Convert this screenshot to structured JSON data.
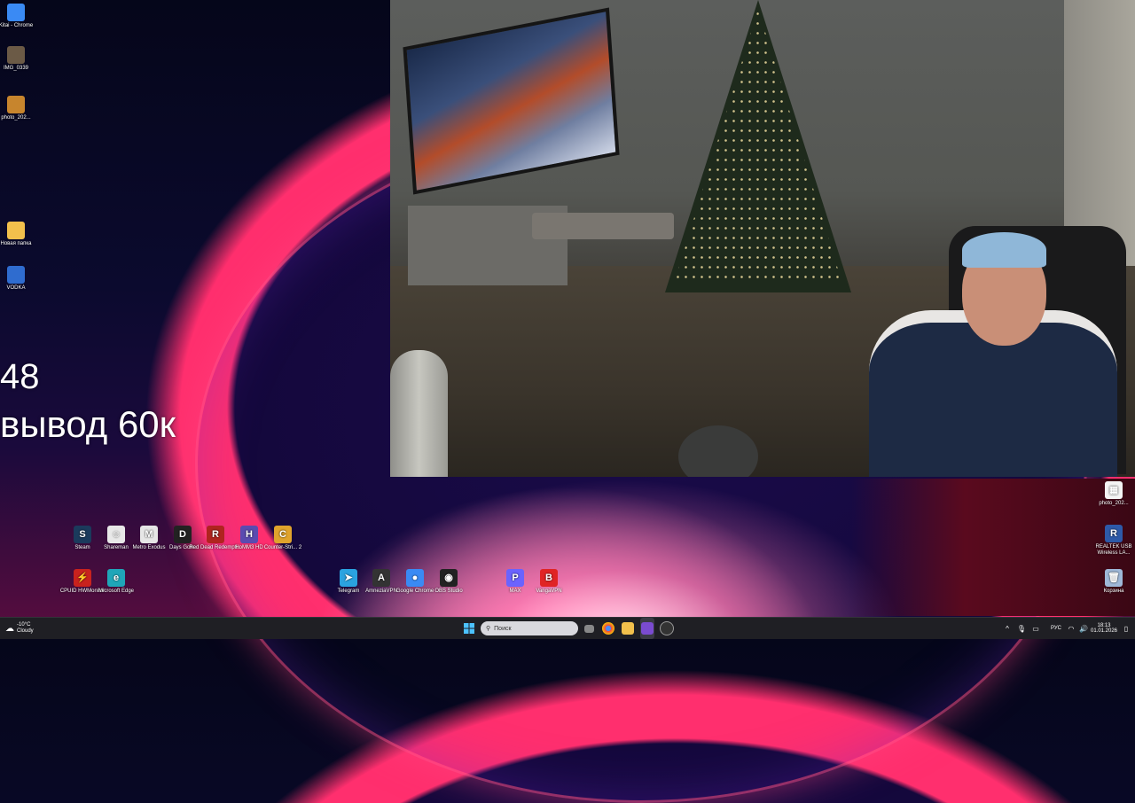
{
  "desktop_left_icons": [
    {
      "name": "chrome-shortcut-kitai",
      "label": "Kitai - Chrome",
      "icon": "chrome-icon",
      "color": "#3a8af4"
    },
    {
      "name": "img-0339",
      "label": "IMG_0339",
      "icon": "image-icon",
      "color": "#6b5a46"
    },
    {
      "name": "photo-202-left",
      "label": "photo_202...",
      "icon": "image-icon",
      "color": "#c7852d"
    },
    {
      "name": "new-folder",
      "label": "Новая папка",
      "icon": "folder-icon",
      "color": "#f2c04c"
    },
    {
      "name": "vodka",
      "label": "VODKA",
      "icon": "app-icon",
      "color": "#2f6ccf"
    }
  ],
  "overlay": {
    "number": "48",
    "text": "вывод 60к"
  },
  "desktop_games_row1": [
    {
      "name": "steam",
      "label": "Steam",
      "color": "#1b3a5c",
      "glyph": "S"
    },
    {
      "name": "shareman",
      "label": "Shareman",
      "color": "#e8e8e8",
      "glyph": "☺"
    },
    {
      "name": "metro-exodus",
      "label": "Metro Exodus",
      "color": "#e6e6e6",
      "glyph": "M"
    },
    {
      "name": "days-gone",
      "label": "Days Gone",
      "color": "#222",
      "glyph": "D"
    },
    {
      "name": "red-dead",
      "label": "Red Dead Redempti...",
      "color": "#b0241f",
      "glyph": "R"
    },
    {
      "name": "homm3",
      "label": "HoMM3 HD",
      "color": "#5a4bb0",
      "glyph": "H"
    },
    {
      "name": "counter-strike",
      "label": "Counter-Stri... 2",
      "color": "#e0a32c",
      "glyph": "C"
    }
  ],
  "desktop_games_row2": [
    {
      "name": "cpuid",
      "label": "CPUID HWMonitor",
      "color": "#c9221e",
      "glyph": "⚡"
    },
    {
      "name": "edge",
      "label": "Microsoft Edge",
      "color": "#1fa6b8",
      "glyph": "e"
    }
  ],
  "desktop_apps_row": [
    {
      "name": "telegram",
      "label": "Telegram",
      "color": "#2aa3e0",
      "glyph": "➤"
    },
    {
      "name": "amneziavpn",
      "label": "AmneziaVPN",
      "color": "#333",
      "glyph": "A"
    },
    {
      "name": "google-chrome",
      "label": "Google Chrome",
      "color": "#3a8af4",
      "glyph": "●"
    },
    {
      "name": "obs-studio",
      "label": "OBS Studio",
      "color": "#222",
      "glyph": "◉"
    },
    {
      "name": "app-p",
      "label": "MAX",
      "color": "#6a63ff",
      "glyph": "P"
    },
    {
      "name": "vpn-b",
      "label": "VangaVPN",
      "color": "#e02424",
      "glyph": "B"
    }
  ],
  "desktop_right_icons": [
    {
      "name": "photo-202-right",
      "label": "photo_202...",
      "color": "#f4f4f4",
      "glyph": "▦"
    },
    {
      "name": "realtek",
      "label": "REALTEK USB Wireless LA...",
      "color": "#2d5aa8",
      "glyph": "R"
    },
    {
      "name": "recycle-bin",
      "label": "Корзина",
      "color": "#9fb8d8",
      "glyph": "🗑"
    }
  ],
  "taskbar": {
    "weather_temp": "-10°C",
    "weather_desc": "Cloudy",
    "search_placeholder": "Поиск",
    "lang": "РУС",
    "time": "18:13",
    "date": "01.01.2026",
    "pinned": [
      "task-view",
      "explorer-icon",
      "chrome-icon",
      "folder-icon",
      "store-icon",
      "obs-icon"
    ]
  }
}
